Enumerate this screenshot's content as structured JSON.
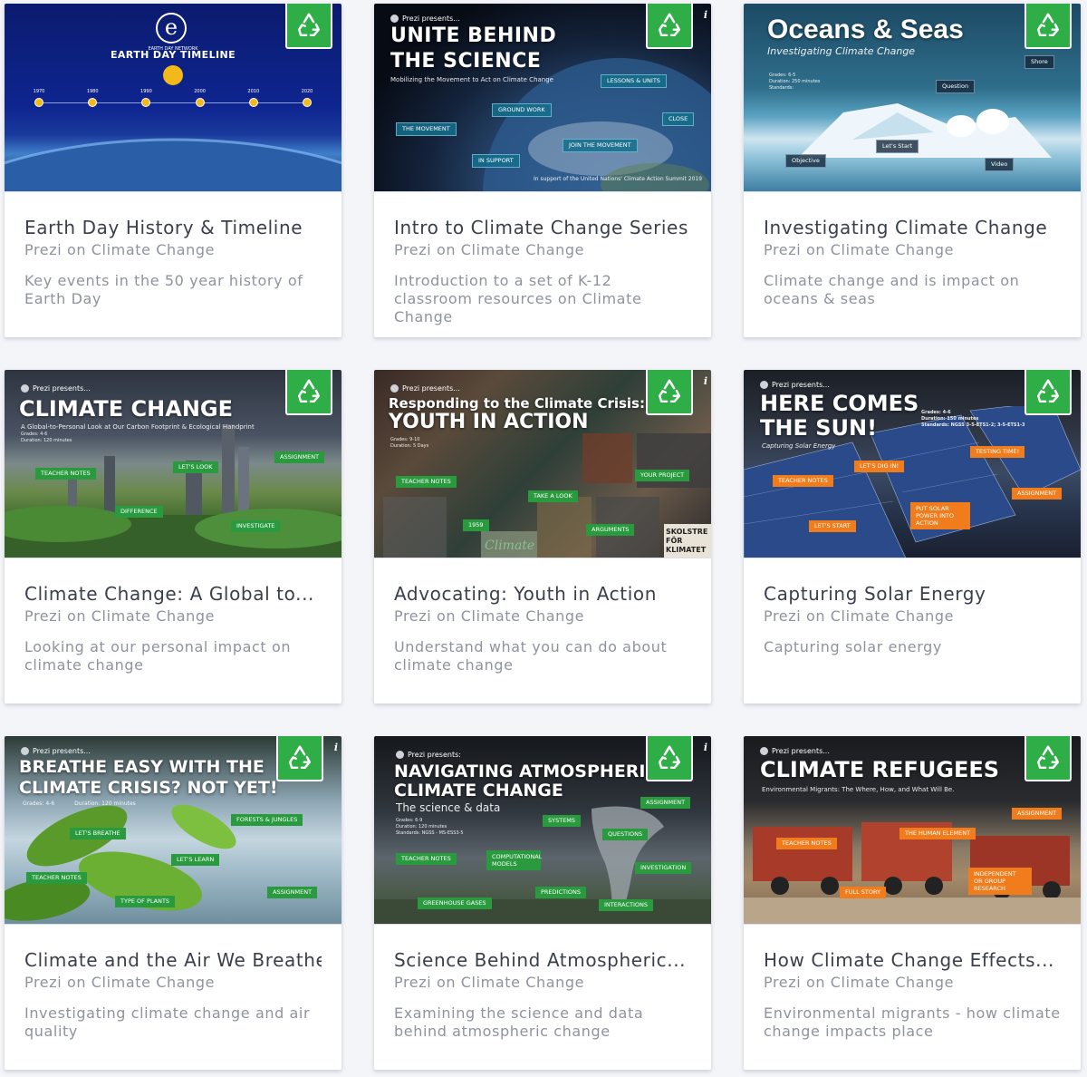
{
  "cards": [
    {
      "title": "Earth Day History & Timeline",
      "author": "Prezi on Climate Change",
      "description": "Key events in the 50 year history of Earth Day",
      "thumb": {
        "logo_letter": "e",
        "logo_caption": "EARTH DAY NETWORK",
        "headline": "EARTH DAY TIMELINE",
        "years": [
          "1970",
          "1980",
          "1990",
          "2000",
          "2010",
          "2020"
        ]
      }
    },
    {
      "title": "Intro to Climate Change Series",
      "author": "Prezi on Climate Change",
      "description": "Introduction to a set of K-12 classroom resources on Climate Change",
      "thumb": {
        "presents": "Prezi presents...",
        "headline_1": "UNITE BEHIND",
        "headline_2": "THE SCIENCE",
        "sub": "Mobilizing the Movement to Act on Climate Change",
        "footer": "In support of the United Nations' Climate Action Summit 2019",
        "tags": [
          "LESSONS & UNITS",
          "GROUND WORK",
          "CLOSE",
          "THE MOVEMENT",
          "JOIN THE MOVEMENT",
          "IN SUPPORT"
        ]
      }
    },
    {
      "title": "Investigating Climate Change",
      "author": "Prezi on Climate Change",
      "description": "Climate change and is impact on oceans & seas",
      "thumb": {
        "headline": "Oceans & Seas",
        "sub": "Investigating Climate Change",
        "details": [
          "Grades: 6-5",
          "Duration: 250 minutes",
          "Standards:"
        ],
        "tags": [
          "Shore",
          "Question",
          "Let's Start",
          "Objective",
          "Video"
        ]
      }
    },
    {
      "title": "Climate Change: A Global to...",
      "author": "Prezi on Climate Change",
      "description": "Looking at our personal impact on climate change",
      "thumb": {
        "presents": "Prezi presents...",
        "headline": "CLIMATE CHANGE",
        "sub": "A Global-to-Personal Look at Our Carbon Footprint & Ecological Handprint",
        "details": [
          "Grades: 4-6",
          "Duration: 120 minutes"
        ],
        "tags": [
          "TEACHER NOTES",
          "LET'S LOOK",
          "ASSIGNMENT",
          "DIFFERENCE",
          "INVESTIGATE"
        ]
      }
    },
    {
      "title": "Advocating: Youth in Action",
      "author": "Prezi on Climate Change",
      "description": "Understand what you can do about climate change",
      "thumb": {
        "presents": "Prezi presents...",
        "headline_1": "Responding to the Climate Crisis:",
        "headline_2": "YOUTH IN ACTION",
        "details": [
          "Grades: 9-10",
          "Duration: 5 Days"
        ],
        "tags": [
          "TEACHER NOTES",
          "YOUR PROJECT",
          "TAKE A LOOK",
          "1959",
          "ARGUMENTS"
        ],
        "sign_1": "Climate",
        "sign_2": "SKOLSTREJK FÖR KLIMATET"
      }
    },
    {
      "title": "Capturing Solar Energy",
      "author": "Prezi on Climate Change",
      "description": "Capturing solar energy",
      "thumb": {
        "presents": "Prezi presents...",
        "headline_1": "HERE COMES",
        "headline_2": "THE SUN!",
        "sub": "Capturing Solar Energy",
        "details": [
          "Grades: 4-6",
          "Duration: 150 minutes",
          "Standards: NGSS 3-5-ETS1-2; 3-5-ETS1-3"
        ],
        "tags": [
          "TESTING TIME!",
          "LET'S DIG IN!",
          "TEACHER NOTES",
          "ASSIGNMENT",
          "PUT SOLAR POWER INTO ACTION",
          "LET'S START"
        ]
      }
    },
    {
      "title": "Climate and the Air We Breathe",
      "author": "Prezi on Climate Change",
      "description": "Investigating climate change and air quality",
      "thumb": {
        "presents": "Prezi presents...",
        "headline_1": "BREATHE EASY WITH THE",
        "headline_2": "CLIMATE CRISIS? NOT YET!",
        "details": [
          "Grades: 4-6",
          "Duration: 120 minutes"
        ],
        "tags": [
          "LET'S BREATHE",
          "FORESTS & JUNGLES",
          "LET'S LEARN",
          "TEACHER NOTES",
          "TYPE OF PLANTS",
          "ASSIGNMENT"
        ]
      }
    },
    {
      "title": "Science Behind Atmospheric...",
      "author": "Prezi on Climate Change",
      "description": "Examining the science and data behind atmospheric change",
      "thumb": {
        "presents": "Prezi presents:",
        "headline_1": "NAVIGATING ATMOSPHERIC",
        "headline_2": "CLIMATE CHANGE",
        "sub": "The science & data",
        "details": [
          "Grades: 6-9",
          "Duration: 120 minutes",
          "Standards: NGSS - MS-ESS3-5"
        ],
        "tags": [
          "ASSIGNMENT",
          "SYSTEMS",
          "QUESTIONS",
          "TEACHER NOTES",
          "COMPUTATIONAL MODELS",
          "INVESTIGATION",
          "PREDICTIONS",
          "GREENHOUSE GASES",
          "INTERACTIONS"
        ]
      }
    },
    {
      "title": "How Climate Change Effects...",
      "author": "Prezi on Climate Change",
      "description": "Environmental migrants - how climate change impacts place",
      "thumb": {
        "presents": "Prezi presents...",
        "headline": "CLIMATE REFUGEES",
        "sub": "Environmental Migrants: The Where, How, and What Will Be.",
        "tags": [
          "ASSIGNMENT",
          "THE HUMAN ELEMENT",
          "TEACHER NOTES",
          "INDEPENDENT OR GROUP RESEARCH",
          "FULL STORY"
        ]
      }
    }
  ],
  "badge": {
    "icon": "recycle-icon",
    "color": "#2fae48"
  },
  "info_glyph": "i"
}
